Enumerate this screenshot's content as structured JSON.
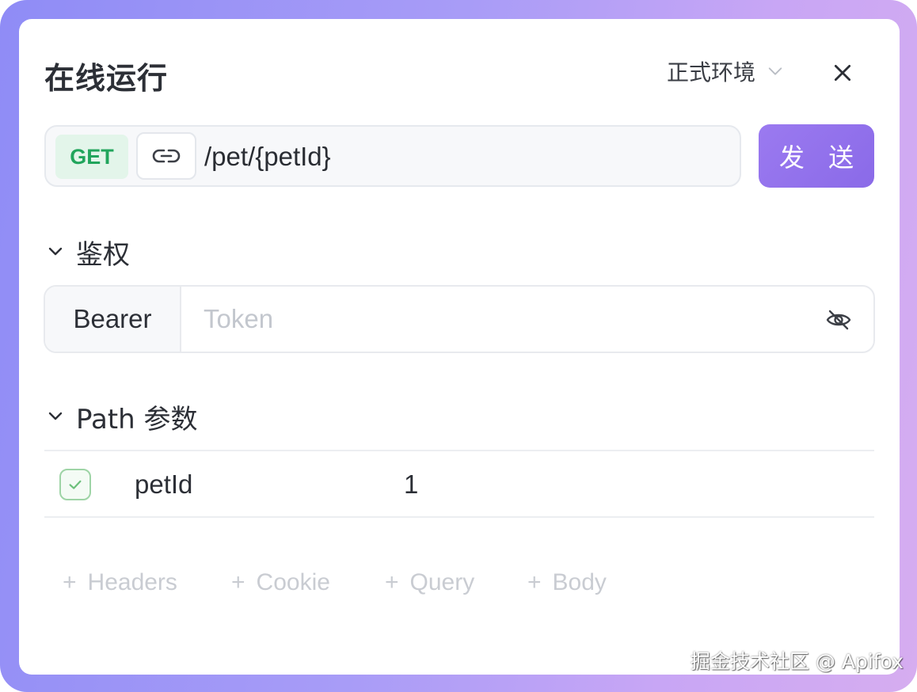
{
  "dialog": {
    "title": "在线运行",
    "environment": "正式环境"
  },
  "request": {
    "method": "GET",
    "path": "/pet/{petId}",
    "send_label": "发 送"
  },
  "auth": {
    "section_label": "鉴权",
    "scheme": "Bearer",
    "token_placeholder": "Token",
    "token_value": ""
  },
  "path_params": {
    "section_label": "Path 参数",
    "rows": [
      {
        "enabled": true,
        "name": "petId",
        "value": "1"
      }
    ]
  },
  "add_buttons": [
    {
      "label": "Headers"
    },
    {
      "label": "Cookie"
    },
    {
      "label": "Query"
    },
    {
      "label": "Body"
    }
  ],
  "watermark": "掘金技术社区 @ Apifox",
  "colors": {
    "frame_gradient_start": "#8f8cf6",
    "frame_gradient_end": "#d6adf0",
    "send_button": "#8a6ae8",
    "method_get_text": "#21a55c",
    "method_get_bg": "#e3f5ea",
    "checkbox_border": "#9ed4a6"
  },
  "icons": [
    "chevron-down-icon",
    "close-icon",
    "link-icon",
    "eye-off-icon",
    "check-icon",
    "plus-icon"
  ]
}
